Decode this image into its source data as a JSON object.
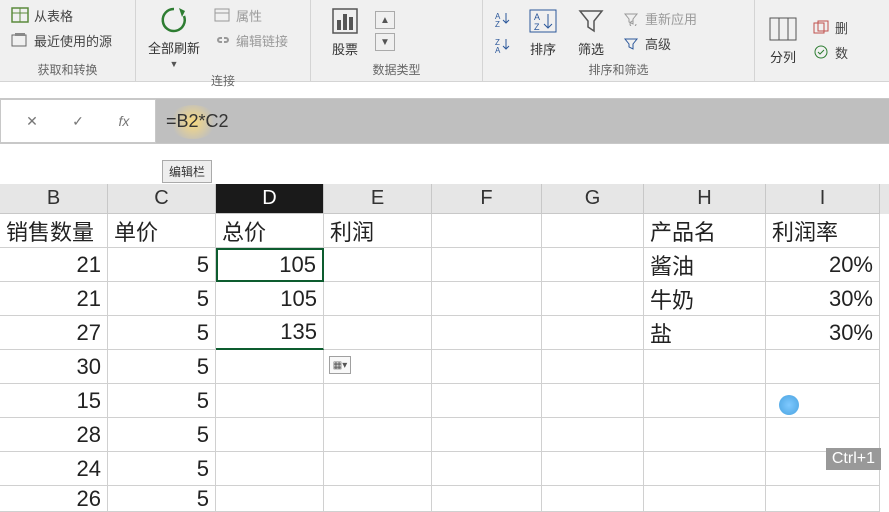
{
  "ribbon": {
    "group_get": {
      "label": "获取和转换",
      "from_table": "从表格",
      "recent_sources": "最近使用的源"
    },
    "group_conn": {
      "label": "连接",
      "refresh_all": "全部刷新",
      "properties": "属性",
      "edit_links": "编辑链接"
    },
    "group_type": {
      "label": "数据类型",
      "stocks": "股票"
    },
    "group_sort": {
      "label": "排序和筛选",
      "sort": "排序",
      "filter": "筛选",
      "reapply": "重新应用",
      "advanced": "高级"
    },
    "group_tools": {
      "split": "分列",
      "remove_dup": "删",
      "validate": "数"
    }
  },
  "formula_bar": {
    "fx": "fx",
    "formula": "=B2*C2",
    "tooltip": "编辑栏"
  },
  "columns": [
    "B",
    "C",
    "D",
    "E",
    "F",
    "G",
    "H",
    "I"
  ],
  "headers": {
    "B": "销售数量",
    "C": "单价",
    "D": "总价",
    "E": "利润",
    "H": "产品名",
    "I": "利润率"
  },
  "rows": [
    {
      "B": "21",
      "C": "5",
      "D": "105",
      "H": "酱油",
      "I": "20%"
    },
    {
      "B": "21",
      "C": "5",
      "D": "105",
      "H": "牛奶",
      "I": "30%"
    },
    {
      "B": "27",
      "C": "5",
      "D": "135",
      "H": "盐",
      "I": "30%"
    },
    {
      "B": "30",
      "C": "5"
    },
    {
      "B": "15",
      "C": "5"
    },
    {
      "B": "28",
      "C": "5"
    },
    {
      "B": "24",
      "C": "5"
    },
    {
      "B": "26",
      "C": "5"
    }
  ],
  "active_cell": "D2",
  "shortcut_hint": "Ctrl+1"
}
